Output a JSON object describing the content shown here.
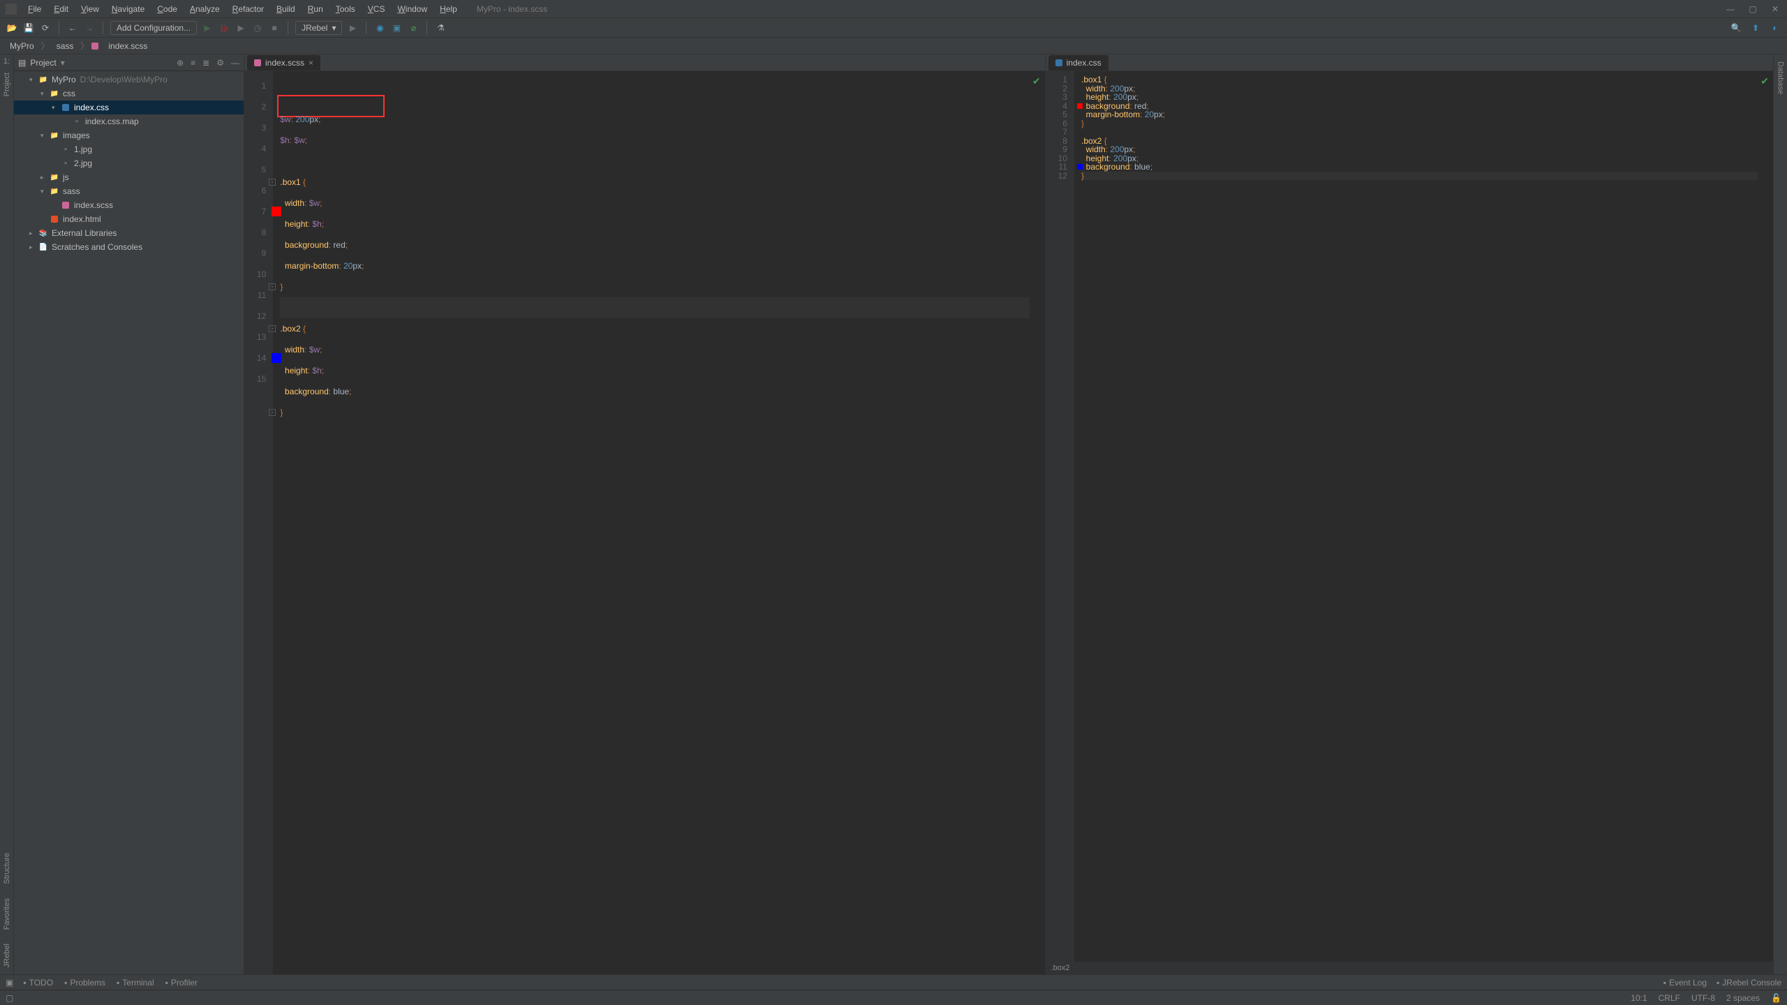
{
  "window": {
    "title": "MyPro - index.scss"
  },
  "menu": [
    "File",
    "Edit",
    "View",
    "Navigate",
    "Code",
    "Analyze",
    "Refactor",
    "Build",
    "Run",
    "Tools",
    "VCS",
    "Window",
    "Help"
  ],
  "toolbar": {
    "add_config": "Add Configuration...",
    "jrebel": "JRebel"
  },
  "breadcrumb": [
    "MyPro",
    "sass",
    "index.scss"
  ],
  "project": {
    "header": "Project",
    "root": {
      "name": "MyPro",
      "path": "D:\\Develop\\Web\\MyPro"
    },
    "tree": [
      {
        "depth": 2,
        "arrow": "v",
        "type": "folder",
        "name": "css"
      },
      {
        "depth": 3,
        "arrow": "v",
        "type": "css",
        "name": "index.css",
        "selected": true
      },
      {
        "depth": 4,
        "arrow": "",
        "type": "file",
        "name": "index.css.map"
      },
      {
        "depth": 2,
        "arrow": "v",
        "type": "folder",
        "name": "images"
      },
      {
        "depth": 3,
        "arrow": "",
        "type": "file",
        "name": "1.jpg"
      },
      {
        "depth": 3,
        "arrow": "",
        "type": "file",
        "name": "2.jpg"
      },
      {
        "depth": 2,
        "arrow": ">",
        "type": "folder",
        "name": "js"
      },
      {
        "depth": 2,
        "arrow": "v",
        "type": "folder",
        "name": "sass"
      },
      {
        "depth": 3,
        "arrow": "",
        "type": "sass",
        "name": "index.scss"
      },
      {
        "depth": 2,
        "arrow": "",
        "type": "html",
        "name": "index.html"
      },
      {
        "depth": 1,
        "arrow": ">",
        "type": "lib",
        "name": "External Libraries"
      },
      {
        "depth": 1,
        "arrow": ">",
        "type": "scratch",
        "name": "Scratches and Consoles"
      }
    ]
  },
  "editorLeft": {
    "tab": "index.scss",
    "highlight_line": 2,
    "lines": [
      {
        "n": 1,
        "tokens": [
          [
            "$w",
            "var"
          ],
          [
            ": ",
            "punc"
          ],
          [
            "200",
            "num"
          ],
          [
            "px",
            "unit"
          ],
          [
            ";",
            "punc"
          ]
        ]
      },
      {
        "n": 2,
        "tokens": [
          [
            "$h",
            "var"
          ],
          [
            ": ",
            "punc"
          ],
          [
            "$w",
            "var"
          ],
          [
            ";",
            "punc"
          ]
        ]
      },
      {
        "n": 3,
        "tokens": []
      },
      {
        "n": 4,
        "fold": "open",
        "tokens": [
          [
            ".box1",
            "sel"
          ],
          [
            " {",
            "punc"
          ]
        ]
      },
      {
        "n": 5,
        "tokens": [
          [
            "  width",
            "prop"
          ],
          [
            ": ",
            "punc"
          ],
          [
            "$w",
            "var"
          ],
          [
            ";",
            "punc"
          ]
        ]
      },
      {
        "n": 6,
        "tokens": [
          [
            "  height",
            "prop"
          ],
          [
            ": ",
            "punc"
          ],
          [
            "$h",
            "var"
          ],
          [
            ";",
            "punc"
          ]
        ]
      },
      {
        "n": 7,
        "swatch": "#ff0000",
        "tokens": [
          [
            "  background",
            "prop"
          ],
          [
            ": ",
            "punc"
          ],
          [
            "red",
            "color"
          ],
          [
            ";",
            "punc"
          ]
        ]
      },
      {
        "n": 8,
        "tokens": [
          [
            "  margin-bottom",
            "prop"
          ],
          [
            ": ",
            "punc"
          ],
          [
            "20",
            "num"
          ],
          [
            "px",
            "unit"
          ],
          [
            ";",
            "punc"
          ]
        ]
      },
      {
        "n": 9,
        "fold": "close",
        "tokens": [
          [
            "}",
            "punc"
          ]
        ]
      },
      {
        "n": 10,
        "caret": true,
        "tokens": []
      },
      {
        "n": 11,
        "fold": "open",
        "tokens": [
          [
            ".box2",
            "sel"
          ],
          [
            " {",
            "punc"
          ]
        ]
      },
      {
        "n": 12,
        "tokens": [
          [
            "  width",
            "prop"
          ],
          [
            ": ",
            "punc"
          ],
          [
            "$w",
            "var"
          ],
          [
            ";",
            "punc"
          ]
        ]
      },
      {
        "n": 13,
        "tokens": [
          [
            "  height",
            "prop"
          ],
          [
            ": ",
            "punc"
          ],
          [
            "$h",
            "var"
          ],
          [
            ";",
            "punc"
          ]
        ]
      },
      {
        "n": 14,
        "swatch": "#0000ff",
        "tokens": [
          [
            "  background",
            "prop"
          ],
          [
            ": ",
            "punc"
          ],
          [
            "blue",
            "color"
          ],
          [
            ";",
            "punc"
          ]
        ]
      },
      {
        "n": 15,
        "fold": "close",
        "tokens": [
          [
            "}",
            "punc"
          ]
        ]
      }
    ]
  },
  "editorRight": {
    "tab": "index.css",
    "breadcrumb": ".box2",
    "lines": [
      {
        "n": 1,
        "tokens": [
          [
            ".box1",
            "sel"
          ],
          [
            " {",
            "punc"
          ]
        ]
      },
      {
        "n": 2,
        "tokens": [
          [
            "  width",
            "prop"
          ],
          [
            ": ",
            "punc"
          ],
          [
            "200",
            "num"
          ],
          [
            "px",
            "unit"
          ],
          [
            ";",
            "punc"
          ]
        ]
      },
      {
        "n": 3,
        "tokens": [
          [
            "  height",
            "prop"
          ],
          [
            ": ",
            "punc"
          ],
          [
            "200",
            "num"
          ],
          [
            "px",
            "unit"
          ],
          [
            ";",
            "punc"
          ]
        ]
      },
      {
        "n": 4,
        "swatch": "#ff0000",
        "tokens": [
          [
            "  background",
            "prop"
          ],
          [
            ": ",
            "punc"
          ],
          [
            "red",
            "color"
          ],
          [
            ";",
            "punc"
          ]
        ]
      },
      {
        "n": 5,
        "tokens": [
          [
            "  margin-bottom",
            "prop"
          ],
          [
            ": ",
            "punc"
          ],
          [
            "20",
            "num"
          ],
          [
            "px",
            "unit"
          ],
          [
            ";",
            "punc"
          ]
        ]
      },
      {
        "n": 6,
        "tokens": [
          [
            "}",
            "punc"
          ]
        ]
      },
      {
        "n": 7,
        "tokens": []
      },
      {
        "n": 8,
        "tokens": [
          [
            ".box2",
            "sel"
          ],
          [
            " {",
            "punc"
          ]
        ]
      },
      {
        "n": 9,
        "tokens": [
          [
            "  width",
            "prop"
          ],
          [
            ": ",
            "punc"
          ],
          [
            "200",
            "num"
          ],
          [
            "px",
            "unit"
          ],
          [
            ";",
            "punc"
          ]
        ]
      },
      {
        "n": 10,
        "tokens": [
          [
            "  height",
            "prop"
          ],
          [
            ": ",
            "punc"
          ],
          [
            "200",
            "num"
          ],
          [
            "px",
            "unit"
          ],
          [
            ";",
            "punc"
          ]
        ]
      },
      {
        "n": 11,
        "swatch": "#0000ff",
        "tokens": [
          [
            "  background",
            "prop"
          ],
          [
            ": ",
            "punc"
          ],
          [
            "blue",
            "color"
          ],
          [
            ";",
            "punc"
          ]
        ]
      },
      {
        "n": 12,
        "caret": true,
        "tokens": [
          [
            "}",
            "punc"
          ]
        ]
      }
    ]
  },
  "leftGutter": [
    "Structure",
    "Favorites",
    "JRebel"
  ],
  "rightGutter": [
    "Database"
  ],
  "bottomTools": {
    "left": [
      "TODO",
      "Problems",
      "Terminal",
      "Profiler"
    ],
    "right": [
      "Event Log",
      "JRebel Console"
    ]
  },
  "status": {
    "pos": "10:1",
    "eol": "CRLF",
    "enc": "UTF-8",
    "indent": "2 spaces"
  }
}
